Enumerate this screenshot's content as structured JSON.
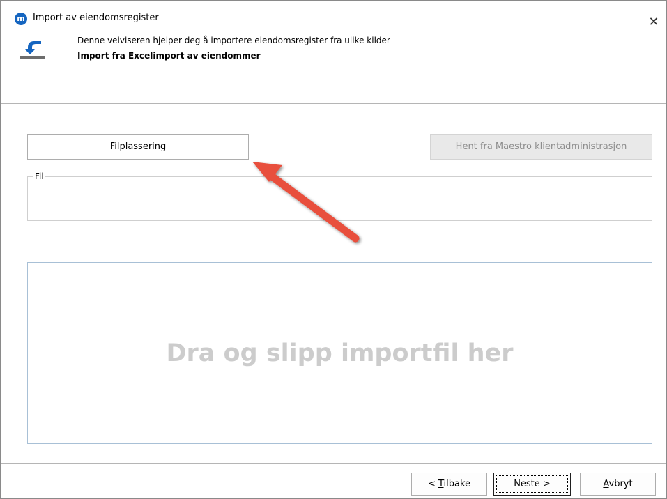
{
  "window": {
    "title": "Import av eiendomsregister",
    "logo_letter": "m",
    "close_glyph": "✕"
  },
  "header": {
    "description": "Denne veiviseren hjelper deg å importere eiendomsregister fra ulike kilder",
    "subtitle": "Import fra Excelimport av eiendommer",
    "icon": "import-arrow-icon"
  },
  "actions": {
    "file_location_label": "Filplassering",
    "fetch_label": "Hent fra Maestro klientadministrasjon"
  },
  "file_group": {
    "label": "Fil",
    "value": ""
  },
  "dropzone": {
    "text": "Dra og slipp importfil her"
  },
  "footer": {
    "back_prefix": "< ",
    "back_mnemonic": "T",
    "back_rest": "ilbake",
    "next_label": "Neste >",
    "cancel_mnemonic": "A",
    "cancel_rest": "vbryt"
  },
  "colors": {
    "accent": "#1565c0",
    "annotation_arrow": "#e8503c",
    "dropzone_border": "#a8c0d6"
  }
}
